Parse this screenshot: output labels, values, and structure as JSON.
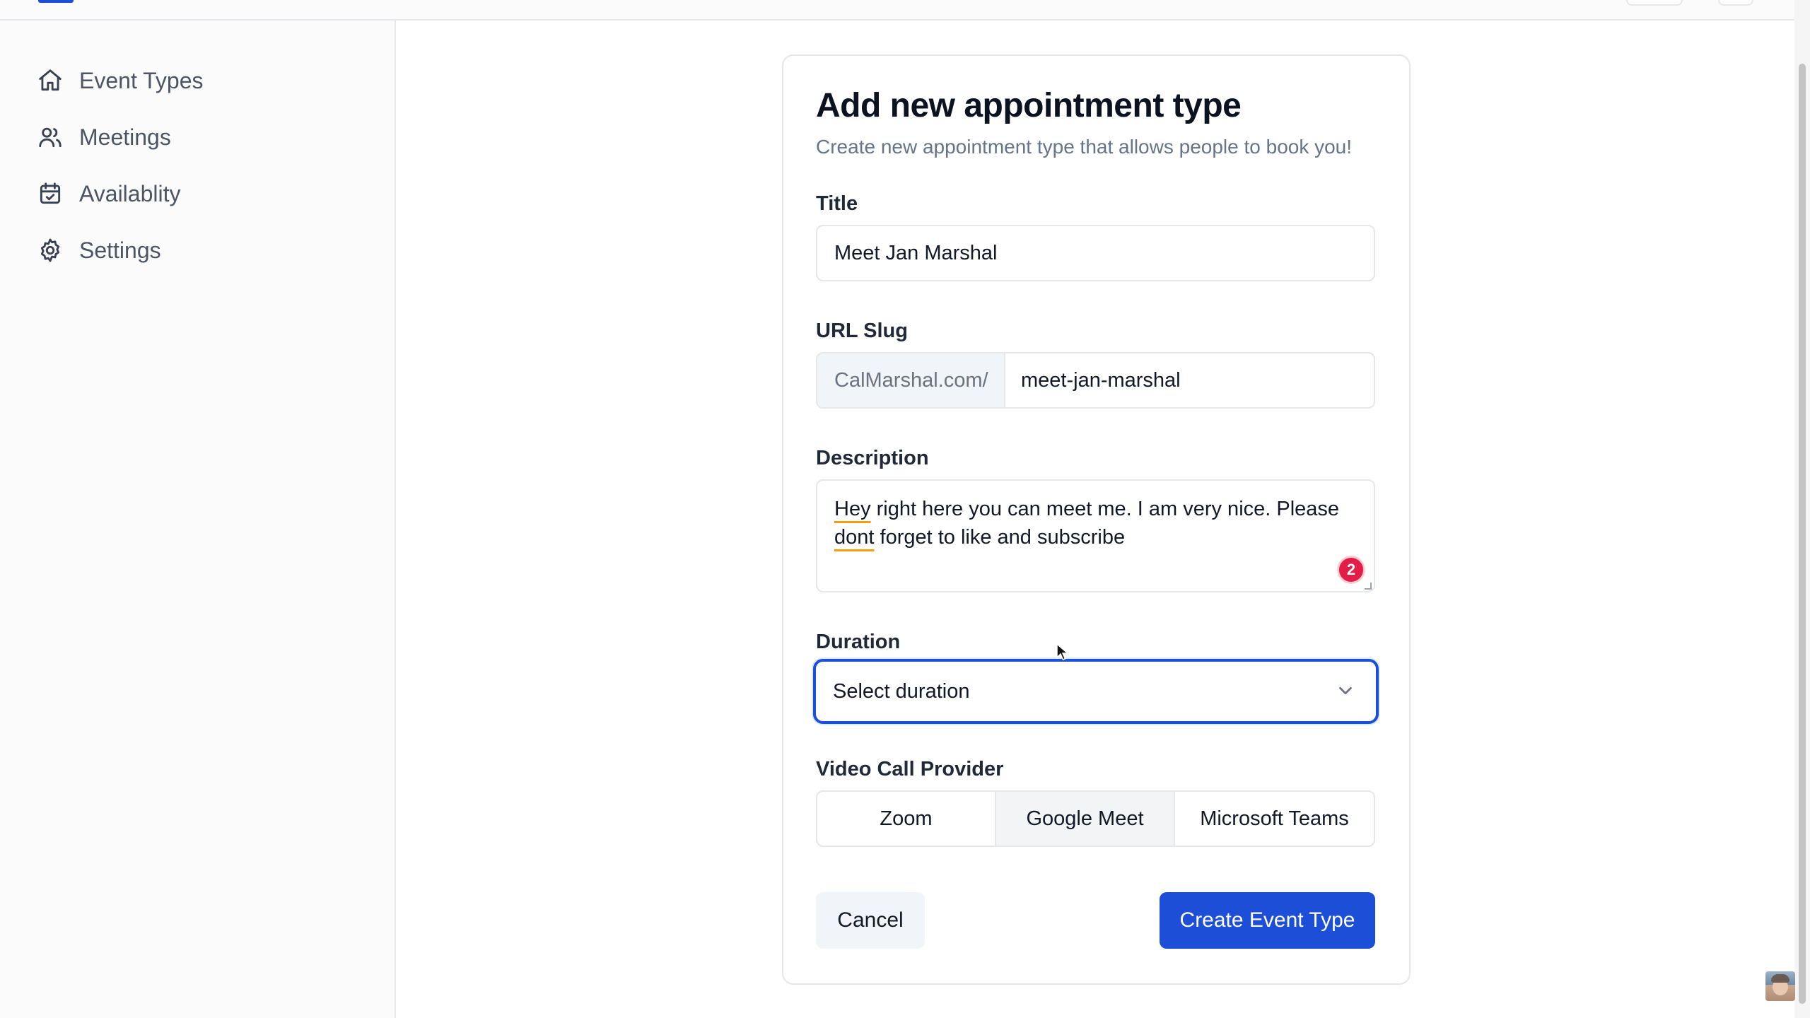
{
  "sidebar": {
    "items": [
      {
        "label": "Event Types",
        "icon": "home-icon"
      },
      {
        "label": "Meetings",
        "icon": "users-icon"
      },
      {
        "label": "Availablity",
        "icon": "calendar-icon"
      },
      {
        "label": "Settings",
        "icon": "gear-icon"
      }
    ]
  },
  "form": {
    "title": "Add new appointment type",
    "subtitle": "Create new appointment type that allows people to book you!",
    "title_label": "Title",
    "title_value": "Meet Jan Marshal",
    "slug_label": "URL Slug",
    "slug_prefix": "CalMarshal.com/",
    "slug_value": "meet-jan-marshal",
    "description_label": "Description",
    "description": {
      "word1": "Hey",
      "part1": " right here you can meet me. I am very nice. Please ",
      "word2": "dont",
      "part2": " forget to like and subscribe"
    },
    "grammar_issue_count": "2",
    "duration_label": "Duration",
    "duration_placeholder": "Select duration",
    "provider_label": "Video Call Provider",
    "providers": [
      "Zoom",
      "Google Meet",
      "Microsoft Teams"
    ],
    "selected_provider": "Google Meet",
    "cancel_label": "Cancel",
    "create_label": "Create Event Type"
  },
  "colors": {
    "accent": "#1d4ed8",
    "badge": "#e11d48",
    "spellcheck_underline": "#f59e0b"
  }
}
